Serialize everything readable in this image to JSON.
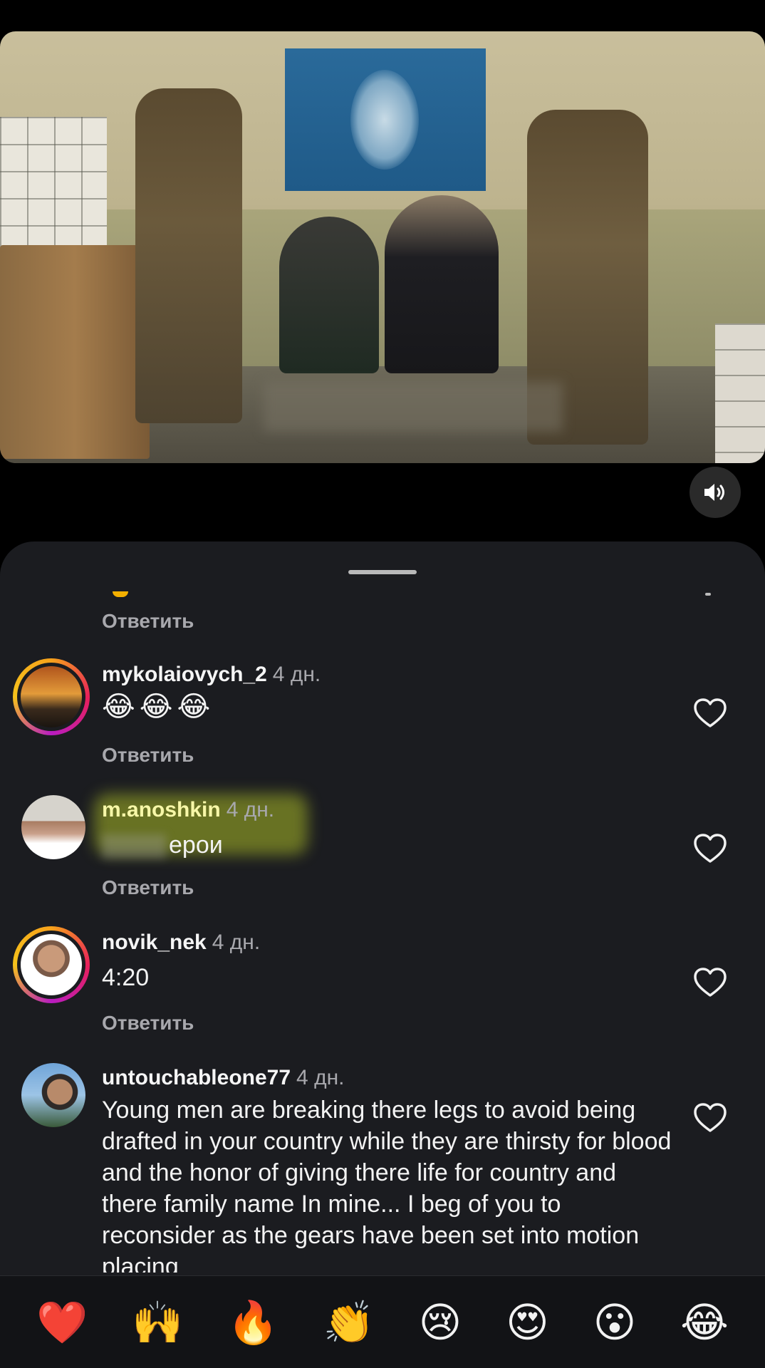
{
  "video": {
    "sound_icon": "speaker-icon"
  },
  "comments_sheet": {
    "reply_label": "Ответить",
    "comments": [
      {
        "username": "mykolaiovych_2",
        "time": "4 дн.",
        "text": "😂😂😂"
      },
      {
        "username": "m.anoshkin",
        "time": "4 дн.",
        "text": "ерои"
      },
      {
        "username": "novik_nek",
        "time": "4 дн.",
        "text": "4:20"
      },
      {
        "username": "untouchableone77",
        "time": "4 дн.",
        "text": "Young men are breaking there legs to avoid being drafted in your country while they are thirsty for blood and the honor of giving there life for country and there family name In mine... I beg of you to reconsider as the gears have been set into motion placing"
      }
    ]
  },
  "reaction_bar": {
    "emojis": [
      "❤️",
      "🙌",
      "🔥",
      "👏",
      "😢",
      "😍",
      "😮",
      "😂"
    ]
  },
  "colors": {
    "sheet_bg": "#1b1c20",
    "highlight": "#c8dc28"
  }
}
